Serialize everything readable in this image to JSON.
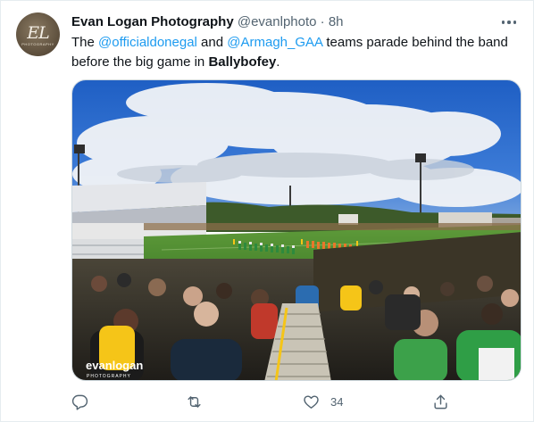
{
  "tweet": {
    "author": {
      "display_name": "Evan Logan Photography",
      "handle": "@evanlphoto",
      "separator": "·",
      "time": "8h",
      "avatar_text": "EL",
      "avatar_caption": "PHOTOGRAPHY"
    },
    "text": {
      "part1": "The ",
      "mention1": "@officialdonegal",
      "part2": " and ",
      "mention2": "@Armagh_GAA",
      "part3": " teams parade behind the band before the big game in ",
      "place": "Ballybofey",
      "part4": "."
    },
    "media": {
      "watermark_name": "evanlogan",
      "watermark_sub": "PHOTOGRAPHY"
    },
    "actions": {
      "reply_count": "",
      "retweet_count": "",
      "like_count": "34",
      "share_count": ""
    },
    "icons": {
      "more": "more-dots-icon",
      "reply": "reply-icon",
      "retweet": "retweet-icon",
      "like": "heart-icon",
      "share": "share-icon"
    },
    "colors": {
      "link": "#1d9bf0",
      "secondary_text": "#536471",
      "primary_text": "#0f1419"
    }
  }
}
